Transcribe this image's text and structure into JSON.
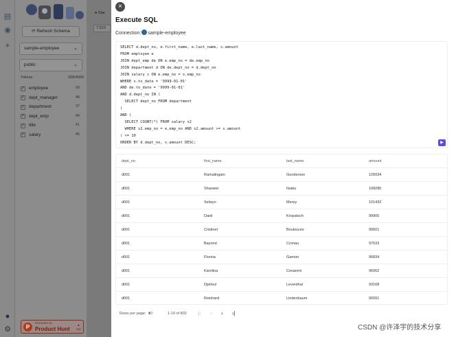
{
  "sidebar": {
    "refresh_label": "Refresh Schema",
    "database": "sample-employee",
    "schema": "public",
    "tables_label": "Tokens",
    "tables_count": "268/4000",
    "tables": [
      {
        "name": "employee",
        "count": "59"
      },
      {
        "name": "dept_manager",
        "count": "48"
      },
      {
        "name": "department",
        "count": "37"
      },
      {
        "name": "dept_emp",
        "count": "48"
      },
      {
        "name": "title",
        "count": "41"
      },
      {
        "name": "salary",
        "count": "45"
      }
    ],
    "producthunt": {
      "small": "FEATURED ON",
      "big": "Product Hunt",
      "votes": "211"
    }
  },
  "middle": {
    "star_label": "Star",
    "pill_label": "7:33:0"
  },
  "modal": {
    "title": "Execute SQL",
    "connection_label": "Connection:",
    "connection_name": "sample-employee",
    "sql_lines": [
      "SELECT d.dept_no, e.first_name, e.last_name, s.amount",
      "FROM employee e",
      "JOIN dept_emp de ON e.emp_no = de.emp_no",
      "JOIN department d ON de.dept_no = d.dept_no",
      "JOIN salary s ON e.emp_no = s.emp_no",
      "WHERE s.to_date = '9999-01-01'",
      "AND de.to_date = '9999-01-01'",
      "AND d.dept_no IN (",
      "  SELECT dept_no FROM department",
      ")",
      "AND (",
      "  SELECT COUNT(*) FROM salary s2",
      "  WHERE s2.emp_no = e.emp_no AND s2.amount >= s.amount",
      ") <= 10",
      "ORDER BY d.dept_no, s.amount DESC;"
    ],
    "columns": [
      "dept_no",
      "first_name",
      "last_name",
      "amount"
    ],
    "rows": [
      [
        "d001",
        "Ramalingam",
        "Gunderson",
        "126034"
      ],
      [
        "d001",
        "Shaowei",
        "Ilsaku",
        "108280"
      ],
      [
        "d001",
        "Selwyn",
        "Merey",
        "101432"
      ],
      [
        "d001",
        "Danil",
        "Kropatsch",
        "99905"
      ],
      [
        "d001",
        "Cristinel",
        "Boulouces",
        "99601"
      ],
      [
        "d001",
        "Bayond",
        "Cronau",
        "97533"
      ],
      [
        "d001",
        "Florina",
        "Garnier",
        "96834"
      ],
      [
        "d001",
        "Karolina",
        "Cesareni",
        "96062"
      ],
      [
        "d001",
        "Djelloul",
        "Leventhal",
        "93168"
      ],
      [
        "d001",
        "Reinhard",
        "Lindenbaum",
        "90091"
      ]
    ],
    "pager": {
      "rows_label": "Rows per page:",
      "rows_value": "10",
      "range": "1-10 of 802"
    }
  },
  "watermark": "CSDN @许泽宇的技术分享"
}
